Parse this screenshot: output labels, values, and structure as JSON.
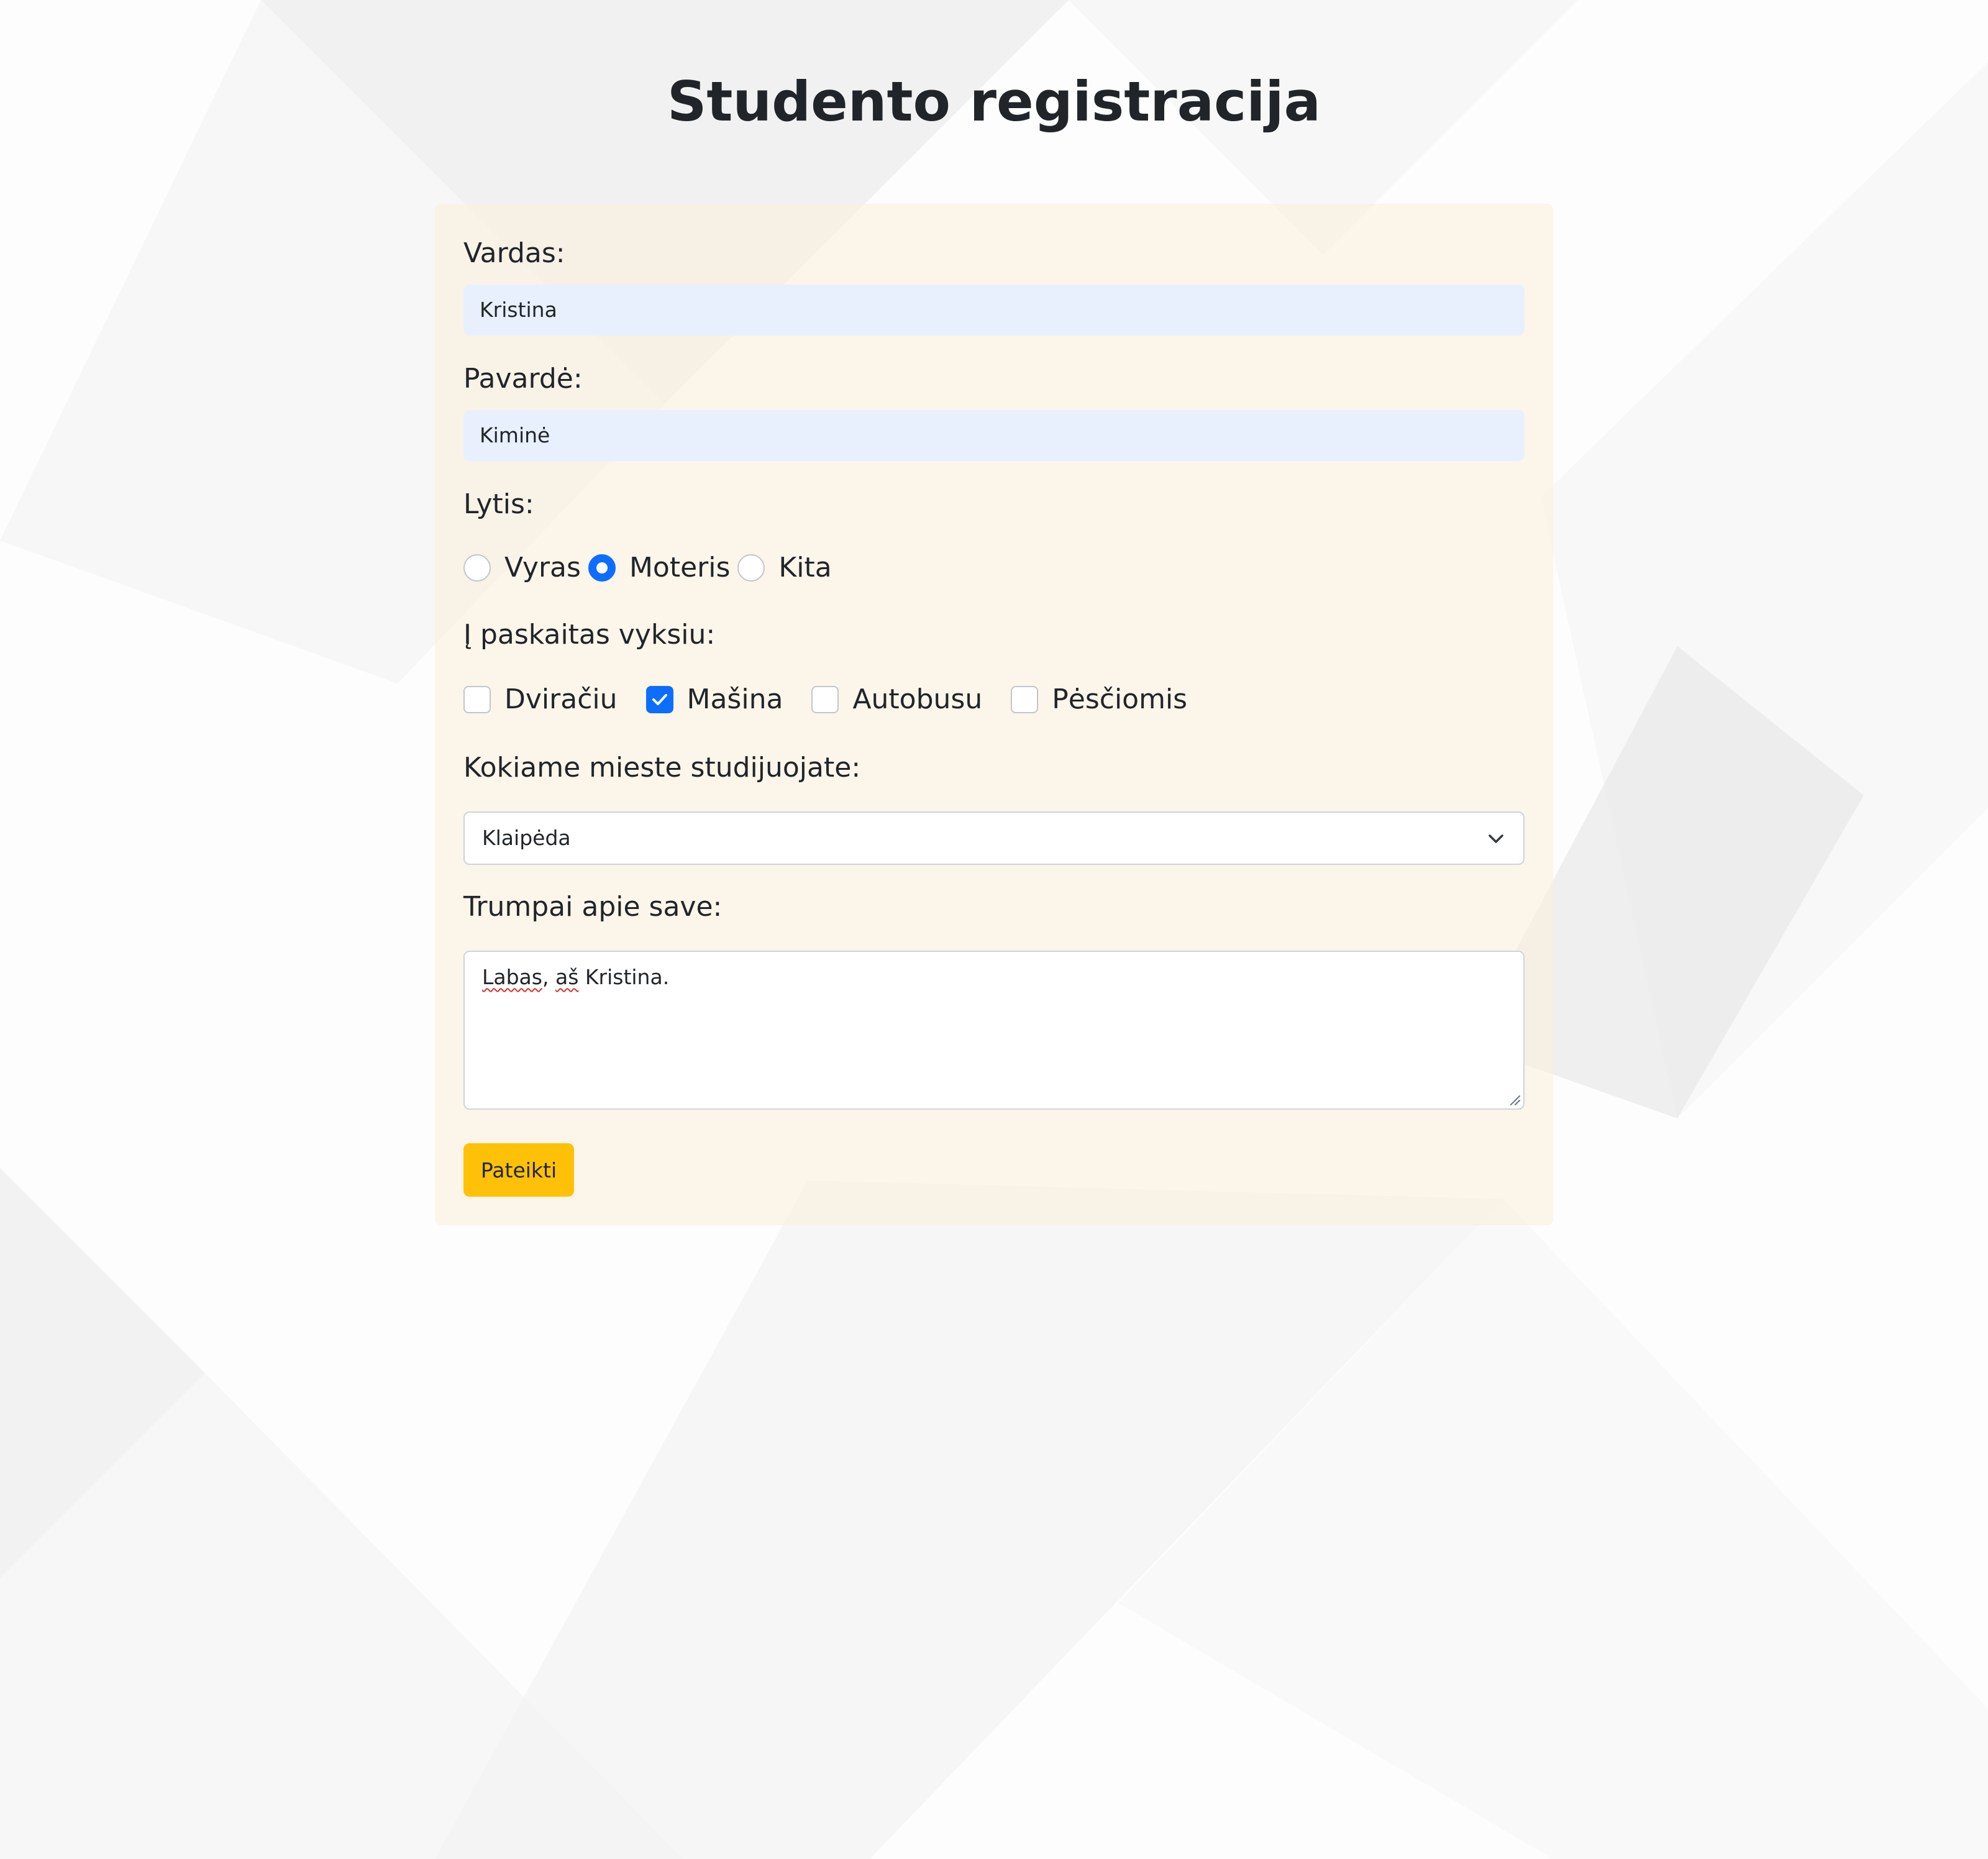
{
  "page": {
    "title": "Studento registracija"
  },
  "form": {
    "first_name": {
      "label": "Vardas:",
      "value": "Kristina"
    },
    "last_name": {
      "label": "Pavardė:",
      "value": "Kiminė"
    },
    "gender": {
      "label": "Lytis:",
      "options": [
        {
          "label": "Vyras",
          "checked": false
        },
        {
          "label": "Moteris",
          "checked": true
        },
        {
          "label": "Kita",
          "checked": false
        }
      ]
    },
    "transport": {
      "label": "Į paskaitas vyksiu:",
      "options": [
        {
          "label": "Dviračiu",
          "checked": false
        },
        {
          "label": "Mašina",
          "checked": true
        },
        {
          "label": "Autobusu",
          "checked": false
        },
        {
          "label": "Pėsčiomis",
          "checked": false
        }
      ]
    },
    "city": {
      "label": "Kokiame mieste studijuojate:",
      "value": "Klaipėda"
    },
    "about": {
      "label": "Trumpai apie save:",
      "words": [
        "Labas",
        ", ",
        "aš",
        " Kristina."
      ]
    },
    "submit_label": "Pateikti"
  },
  "colors": {
    "accent": "#0d6efd",
    "button": "#ffc107",
    "autofill": "#e8f0fe",
    "card": "#faeedb"
  }
}
